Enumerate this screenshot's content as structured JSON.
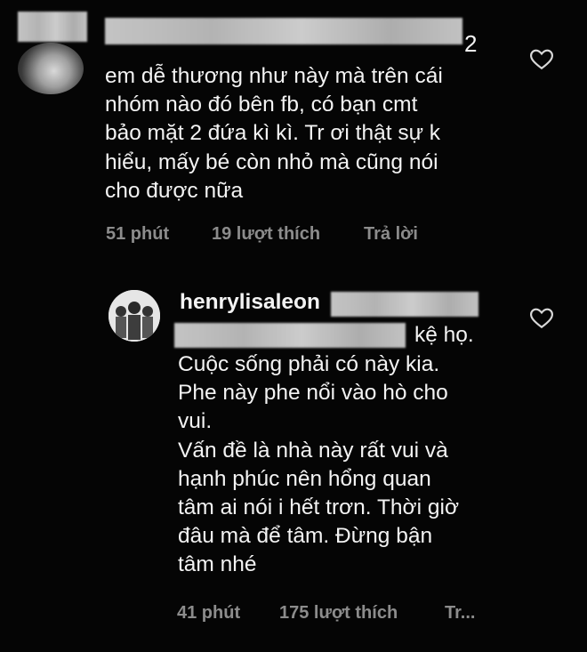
{
  "comment1": {
    "username_suffix": "2",
    "text": "em dễ thương như này mà trên cái\nnhóm nào đó bên fb, có bạn cmt\nbảo mặt 2 đứa kì kì. Tr ơi thật sự k\nhiểu, mấy bé còn nhỏ mà cũng nói\ncho được nữa",
    "time": "51 phút",
    "likes": "19 lượt thích",
    "reply": "Trả lời"
  },
  "comment2": {
    "username": "henrylisaleon",
    "mention_suffix": "kệ họ.",
    "text": "Cuộc sống phải có này kia.\nPhe này phe nổi vào hò cho\nvui.\nVấn đề là nhà này rất vui và\nhạnh phúc nên hổng quan\ntâm ai nói i hết trơn. Thời giờ\nđâu mà để tâm. Đừng bận\ntâm nhé",
    "time": "41 phút",
    "likes": "175 lượt thích",
    "reply": "Tr..."
  },
  "icons": [
    "heart-icon",
    "heart-icon"
  ]
}
